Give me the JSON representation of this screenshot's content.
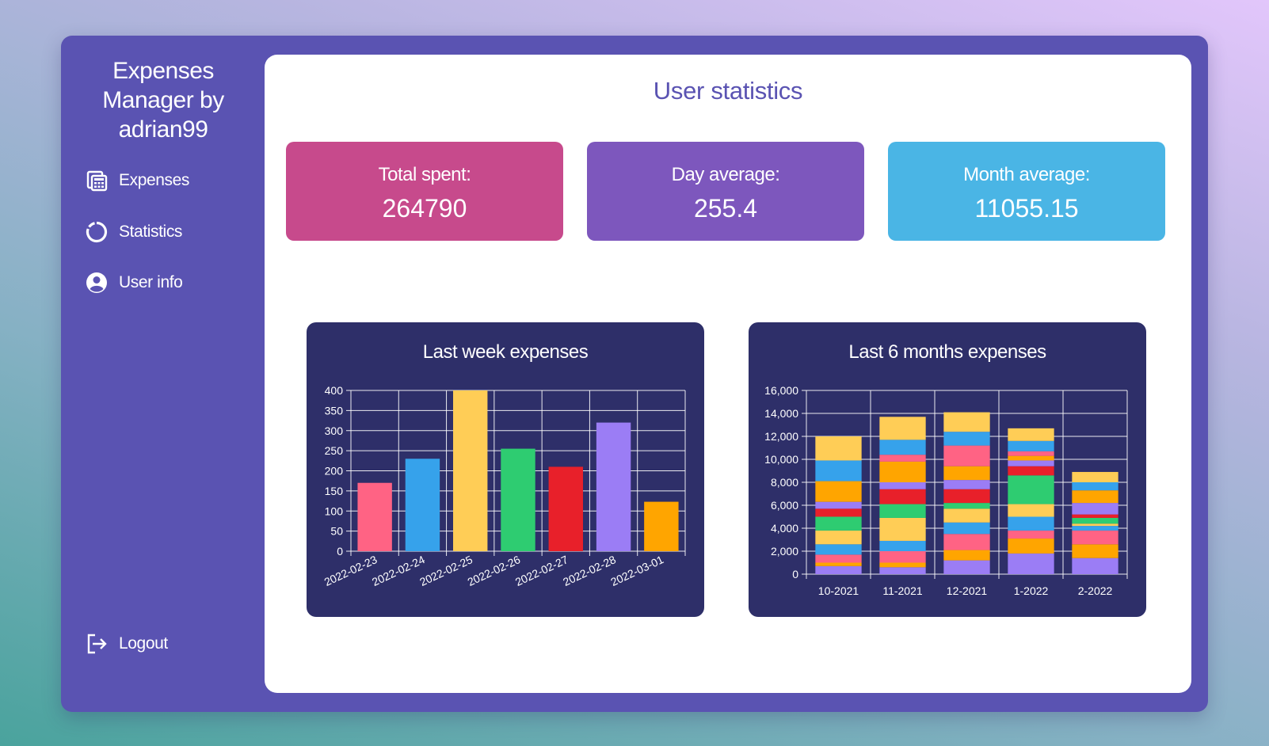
{
  "sidebar": {
    "brand": "Expenses Manager by adrian99",
    "items": [
      {
        "label": "Expenses",
        "icon": "calculator-icon"
      },
      {
        "label": "Statistics",
        "icon": "donut-chart-icon"
      },
      {
        "label": "User info",
        "icon": "user-circle-icon"
      }
    ],
    "logout": {
      "label": "Logout",
      "icon": "logout-icon"
    }
  },
  "main": {
    "title": "User statistics",
    "cards": [
      {
        "label": "Total spent:",
        "value": "264790",
        "color": "#c74a8c"
      },
      {
        "label": "Day average:",
        "value": "255.4",
        "color": "#7d57bd"
      },
      {
        "label": "Month average:",
        "value": "11055.15",
        "color": "#4ab5e5"
      }
    ]
  },
  "colors": {
    "sidebar_bg": "#5a53b2",
    "chart_bg": "#2e2f69",
    "grid": "#ffffff"
  },
  "chart_data": [
    {
      "type": "bar",
      "title": "Last week expenses",
      "categories": [
        "2022-02-23",
        "2022-02-24",
        "2022-02-25",
        "2022-02-26",
        "2022-02-27",
        "2022-02-28",
        "2022-03-01"
      ],
      "values": [
        170,
        230,
        400,
        255,
        210,
        320,
        123
      ],
      "colors": [
        "#ff6384",
        "#36a2eb",
        "#ffcd56",
        "#2ecc71",
        "#e8202a",
        "#9b7df5",
        "#ffa500"
      ],
      "ylim": [
        0,
        400
      ],
      "yticks": [
        0,
        50,
        100,
        150,
        200,
        250,
        300,
        350,
        400
      ],
      "grid": true
    },
    {
      "type": "bar",
      "stacked": true,
      "title": "Last 6 months expenses",
      "categories": [
        "10-2021",
        "11-2021",
        "12-2021",
        "1-2022",
        "2-2022"
      ],
      "ylim": [
        0,
        16000
      ],
      "yticks": [
        "0",
        "2,000",
        "4,000",
        "6,000",
        "8,000",
        "10,000",
        "12,000",
        "14,000",
        "16,000"
      ],
      "grid": true,
      "series": [
        {
          "color": "#9b7df5",
          "values": [
            700,
            600,
            1200,
            1800,
            1400
          ]
        },
        {
          "color": "#ffa500",
          "values": [
            300,
            400,
            900,
            1300,
            1200
          ]
        },
        {
          "color": "#ff6384",
          "values": [
            700,
            1000,
            1400,
            700,
            1200
          ]
        },
        {
          "color": "#36a2eb",
          "values": [
            900,
            900,
            1000,
            1200,
            400
          ]
        },
        {
          "color": "#ffcd56",
          "values": [
            1200,
            2000,
            1200,
            1100,
            200
          ]
        },
        {
          "color": "#2ecc71",
          "values": [
            1200,
            1200,
            500,
            2500,
            500
          ]
        },
        {
          "color": "#e8202a",
          "values": [
            700,
            1300,
            1200,
            800,
            300
          ]
        },
        {
          "color": "#9b7df5",
          "values": [
            600,
            600,
            800,
            500,
            1000
          ]
        },
        {
          "color": "#ffa500",
          "values": [
            1800,
            1800,
            1200,
            400,
            1100
          ]
        },
        {
          "color": "#ff6384",
          "values": [
            0,
            600,
            1800,
            400,
            0
          ]
        },
        {
          "color": "#36a2eb",
          "values": [
            1800,
            1300,
            1200,
            900,
            700
          ]
        },
        {
          "color": "#ffcd56",
          "values": [
            2100,
            2000,
            1700,
            1100,
            900
          ]
        }
      ]
    }
  ]
}
